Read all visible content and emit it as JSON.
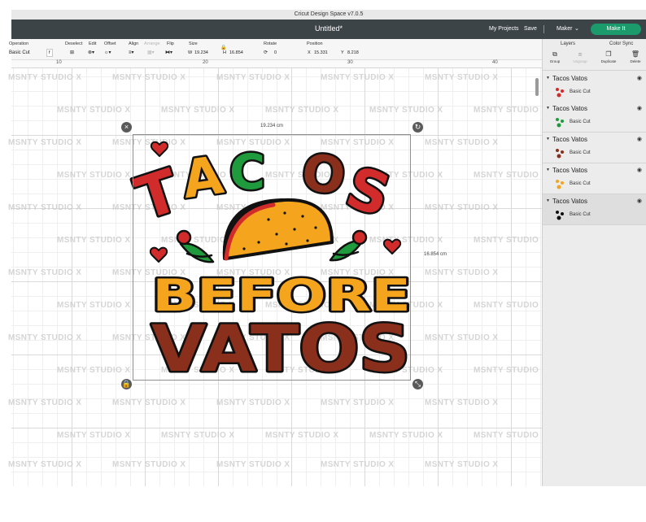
{
  "app": {
    "window_title": "Cricut Design Space  v7.0.5",
    "document_title": "Untitled*",
    "watermark": "MSNTY STUDIO X",
    "accent_color": "#1b9a6c"
  },
  "header": {
    "my_projects": "My Projects",
    "save": "Save",
    "machine": "Maker",
    "make_it": "Make It"
  },
  "toolbar": {
    "operation_label": "Operation",
    "operation_value": "Basic Cut",
    "deselect_label": "Deselect",
    "edit_label": "Edit",
    "offset_label": "Offset",
    "align_label": "Align",
    "arrange_label": "Arrange",
    "flip_label": "Flip",
    "size_label": "Size",
    "size_w_prefix": "W",
    "size_w": "19.234",
    "size_h_prefix": "H",
    "size_h": "16.854",
    "rotate_label": "Rotate",
    "rotate_value": "0",
    "position_label": "Position",
    "pos_x_prefix": "X",
    "pos_x": "15.331",
    "pos_y_prefix": "Y",
    "pos_y": "8.218"
  },
  "ruler": {
    "marks": [
      "10",
      "20",
      "30",
      "40"
    ]
  },
  "selection": {
    "width_label": "19.234 cm",
    "height_label": "16.854 cm"
  },
  "design": {
    "line1": "TACOS",
    "line2": "BEFORE",
    "line3": "VATOS",
    "colors": {
      "red": "#d22b2b",
      "orange": "#f4a41d",
      "green": "#1f9b3d",
      "brown": "#8a2f1c",
      "outline": "#111111"
    }
  },
  "panel": {
    "tab_layers": "Layers",
    "tab_color_sync": "Color Sync",
    "actions": [
      {
        "label": "Group",
        "icon": "group-icon",
        "enabled": true
      },
      {
        "label": "Ungroup",
        "icon": "ungroup-icon",
        "enabled": false
      },
      {
        "label": "Duplicate",
        "icon": "duplicate-icon",
        "enabled": true
      },
      {
        "label": "Delete",
        "icon": "delete-icon",
        "enabled": true
      }
    ],
    "layers": [
      {
        "name": "Tacos Vatos",
        "operation": "Basic Cut",
        "color": "#d22b2b"
      },
      {
        "name": "Tacos Vatos",
        "operation": "Basic Cut",
        "color": "#1f9b3d"
      },
      {
        "name": "Tacos Vatos",
        "operation": "Basic Cut",
        "color": "#8a2f1c"
      },
      {
        "name": "Tacos Vatos",
        "operation": "Basic Cut",
        "color": "#f4a41d"
      },
      {
        "name": "Tacos Vatos",
        "operation": "Basic Cut",
        "color": "#111111"
      }
    ]
  }
}
